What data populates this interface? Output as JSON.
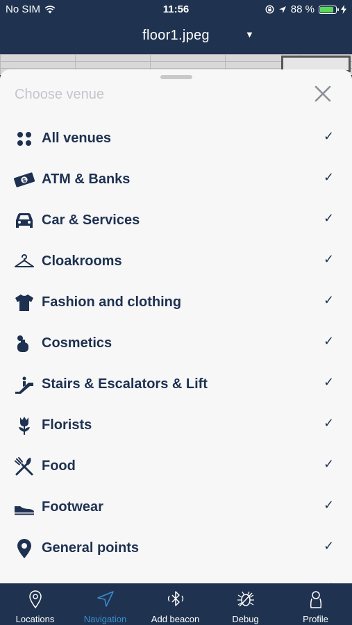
{
  "status_bar": {
    "carrier": "No SIM",
    "time": "11:56",
    "battery_percent_text": "88 %",
    "battery_level": 0.88,
    "icons": [
      "wifi-icon",
      "screen-lock-icon",
      "location-arrow-icon",
      "battery-icon",
      "charging-bolt-icon"
    ]
  },
  "title_bar": {
    "title": "floor1.jpeg",
    "dropdown_caret": "▼"
  },
  "sheet": {
    "header": "Choose venue",
    "close_icon": "close-icon",
    "check_mark": "✓",
    "items": [
      {
        "label": "All venues",
        "icon": "grid-dots-icon",
        "checked": true
      },
      {
        "label": "ATM & Banks",
        "icon": "banknote-icon",
        "checked": true
      },
      {
        "label": "Car & Services",
        "icon": "car-icon",
        "checked": true
      },
      {
        "label": "Cloakrooms",
        "icon": "hanger-icon",
        "checked": true
      },
      {
        "label": "Fashion and clothing",
        "icon": "tshirt-icon",
        "checked": true
      },
      {
        "label": "Cosmetics",
        "icon": "cosmetics-icon",
        "checked": true
      },
      {
        "label": "Stairs & Escalators & Lift",
        "icon": "escalator-icon",
        "checked": true
      },
      {
        "label": "Florists",
        "icon": "flower-icon",
        "checked": true
      },
      {
        "label": "Food",
        "icon": "fork-knife-icon",
        "checked": true
      },
      {
        "label": "Footwear",
        "icon": "shoe-icon",
        "checked": true
      },
      {
        "label": "General points",
        "icon": "map-pin-icon",
        "checked": true
      }
    ]
  },
  "tab_bar": {
    "active": "Navigation",
    "active_color": "#3a8fd0",
    "tabs": [
      {
        "label": "Locations",
        "icon": "location-pin-icon"
      },
      {
        "label": "Navigation",
        "icon": "navigation-arrow-icon"
      },
      {
        "label": "Add beacon",
        "icon": "bluetooth-icon"
      },
      {
        "label": "Debug",
        "icon": "bug-icon"
      },
      {
        "label": "Profile",
        "icon": "user-icon"
      }
    ]
  }
}
